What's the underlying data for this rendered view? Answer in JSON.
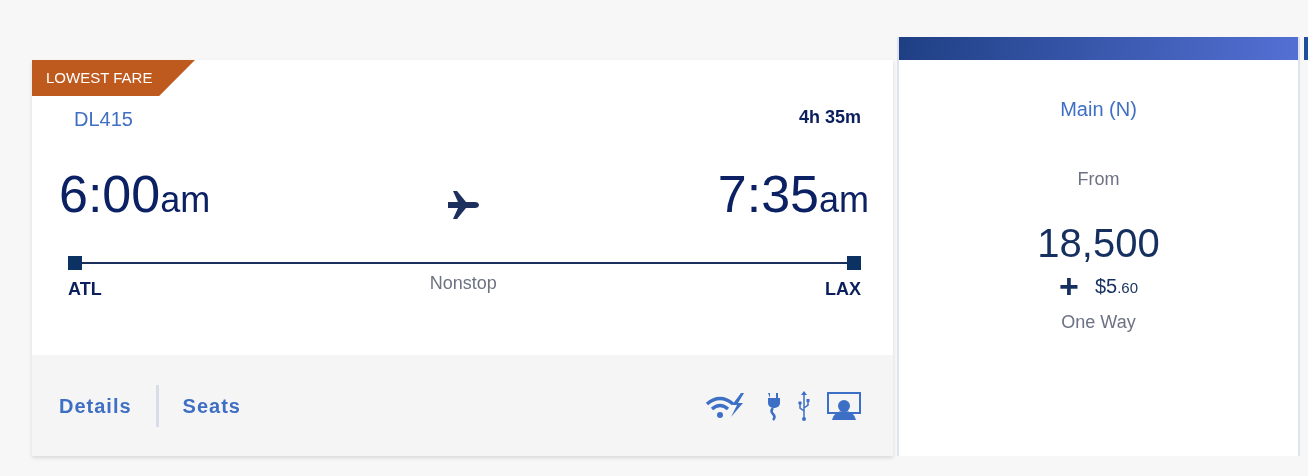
{
  "flight": {
    "badge": "LOWEST FARE",
    "number": "DL415",
    "duration": "4h 35m",
    "depart": {
      "time": "6:00",
      "period": "am",
      "airport": "ATL"
    },
    "arrive": {
      "time": "7:35",
      "period": "am",
      "airport": "LAX"
    },
    "stops": "Nonstop",
    "links": [
      "Details",
      "Seats"
    ],
    "amenities": [
      {
        "kind": "wifi"
      },
      {
        "kind": "power"
      },
      {
        "kind": "usb"
      },
      {
        "kind": "entertainment"
      }
    ]
  },
  "fare": {
    "cabin": "Main (N)",
    "from": "From",
    "miles": "18,500",
    "plus": "+",
    "cash": "$5",
    "cash_cents": ".60",
    "trip": "One Way"
  }
}
